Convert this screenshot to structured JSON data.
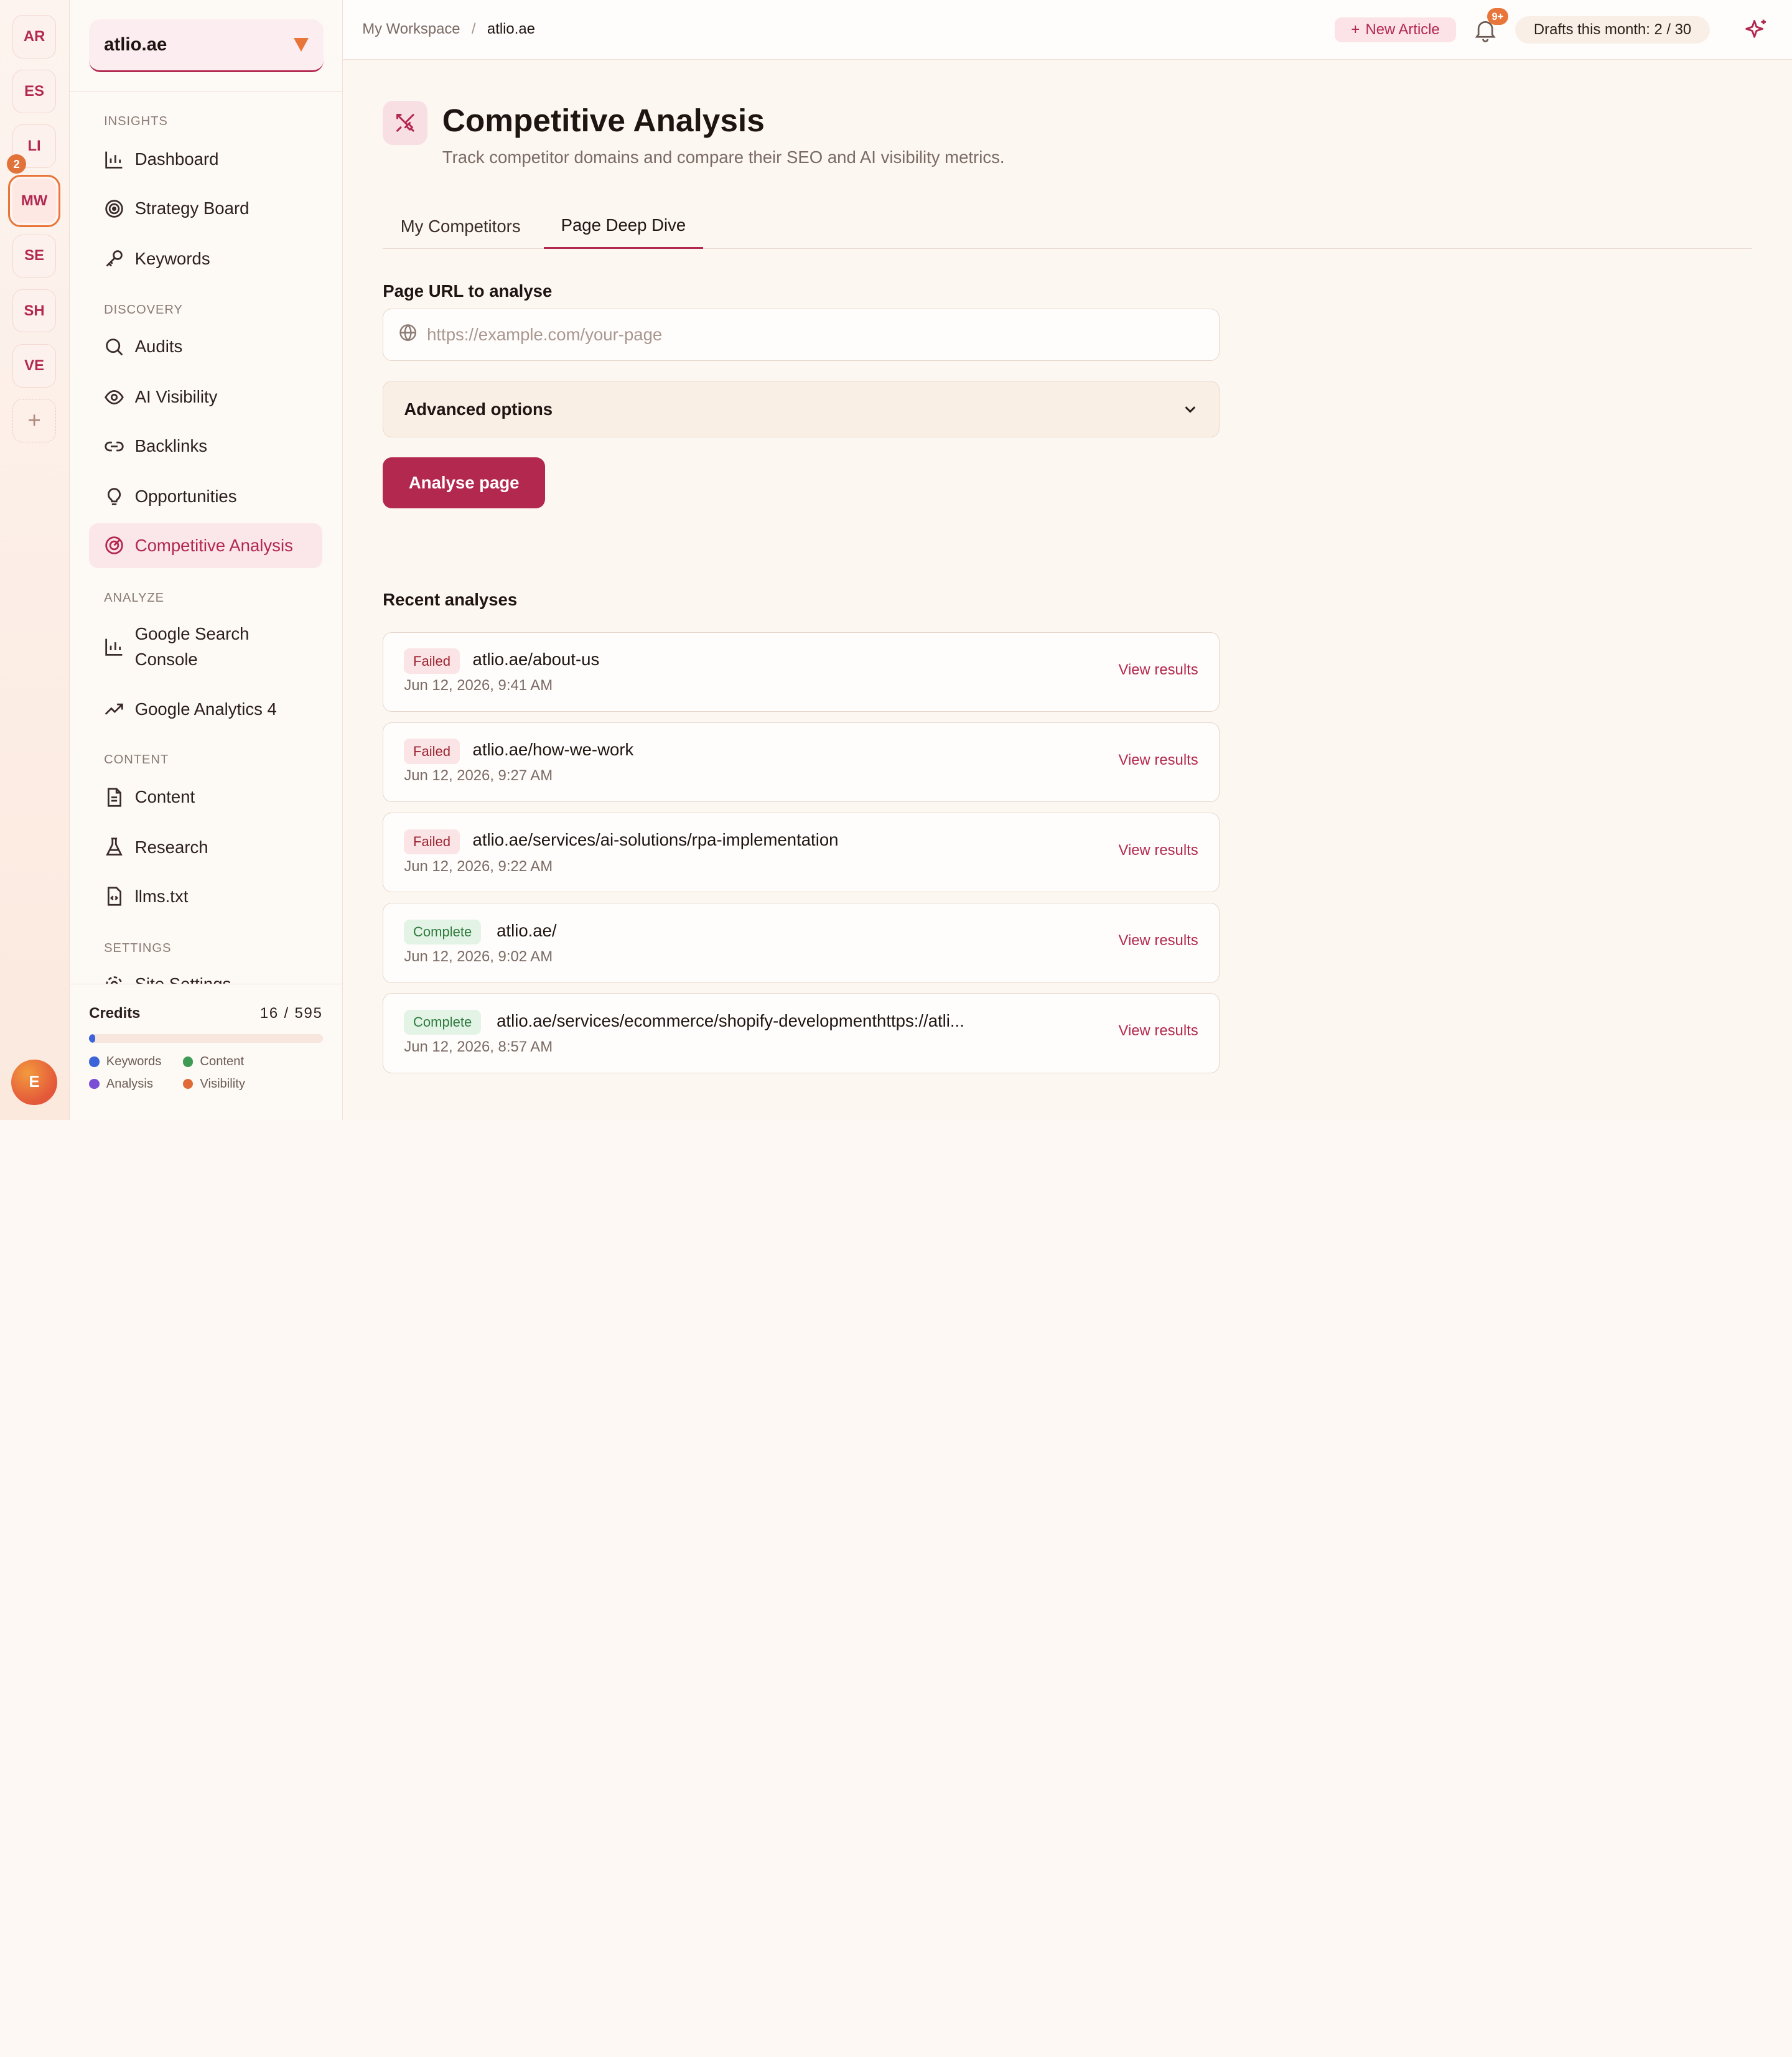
{
  "workspaces": [
    {
      "initials": "AR"
    },
    {
      "initials": "ES"
    },
    {
      "initials": "LI"
    },
    {
      "initials": "MW",
      "active": true,
      "badge": "2"
    },
    {
      "initials": "SE"
    },
    {
      "initials": "SH"
    },
    {
      "initials": "VE"
    }
  ],
  "workspace_badge": "2",
  "add_workspace": "+",
  "user_initial": "E",
  "site_selector": {
    "value": "atlio.ae"
  },
  "sidebar": {
    "sections": {
      "insights": "INSIGHTS",
      "discovery": "DISCOVERY",
      "analyze": "ANALYZE",
      "content": "CONTENT",
      "settings": "SETTINGS"
    },
    "items": {
      "dashboard": "Dashboard",
      "strategy_board": "Strategy Board",
      "keywords": "Keywords",
      "audits": "Audits",
      "ai_visibility": "AI Visibility",
      "backlinks": "Backlinks",
      "opportunities": "Opportunities",
      "competitive_analysis": "Competitive Analysis",
      "google_search_console": "Google Search Console",
      "google_analytics": "Google Analytics 4",
      "content": "Content",
      "research": "Research",
      "llms": "llms.txt",
      "site_settings": "Site Settings"
    }
  },
  "credits": {
    "label": "Credits",
    "used": "16",
    "separator": "/",
    "total": "595",
    "fraction": 0.027,
    "legend": {
      "keywords": "Keywords",
      "content": "Content",
      "analysis": "Analysis",
      "visibility": "Visibility"
    },
    "colors": {
      "keywords": "#3c63d8",
      "content": "#3f9a55",
      "analysis": "#7a4fd6",
      "visibility": "#e06a35"
    }
  },
  "topbar": {
    "breadcrumb_root": "My Workspace",
    "breadcrumb_sep": "/",
    "breadcrumb_current": "atlio.ae",
    "new_article": "New Article",
    "new_article_plus": "+",
    "notifications_badge": "9+",
    "drafts": "Drafts this month: 2 / 30"
  },
  "page": {
    "title": "Competitive Analysis",
    "subtitle": "Track competitor domains and compare their SEO and AI visibility metrics.",
    "tabs": {
      "my_competitors": "My Competitors",
      "page_deep_dive": "Page Deep Dive"
    },
    "url_label": "Page URL to analyse",
    "url_placeholder": "https://example.com/your-page",
    "url_value": "",
    "advanced_options": "Advanced options",
    "analyse_button": "Analyse page",
    "recent_title": "Recent analyses"
  },
  "analyses": [
    {
      "status": "Failed",
      "url": "atlio.ae/about-us",
      "date": "Jun 12, 2026, 9:41 AM",
      "action": "View results"
    },
    {
      "status": "Failed",
      "url": "atlio.ae/how-we-work",
      "date": "Jun 12, 2026, 9:27 AM",
      "action": "View results"
    },
    {
      "status": "Failed",
      "url": "atlio.ae/services/ai-solutions/rpa-implementation",
      "date": "Jun 12, 2026, 9:22 AM",
      "action": "View results"
    },
    {
      "status": "Complete",
      "url": "atlio.ae/",
      "date": "Jun 12, 2026, 9:02 AM",
      "action": "View results"
    },
    {
      "status": "Complete",
      "url": "atlio.ae/services/ecommerce/shopify-developmenthttps://atli...",
      "date": "Jun 12, 2026, 8:57 AM",
      "action": "View results"
    }
  ],
  "colors": {
    "accent": "#b3284f",
    "orange": "#e8763a",
    "background": "#fdf7f2"
  }
}
